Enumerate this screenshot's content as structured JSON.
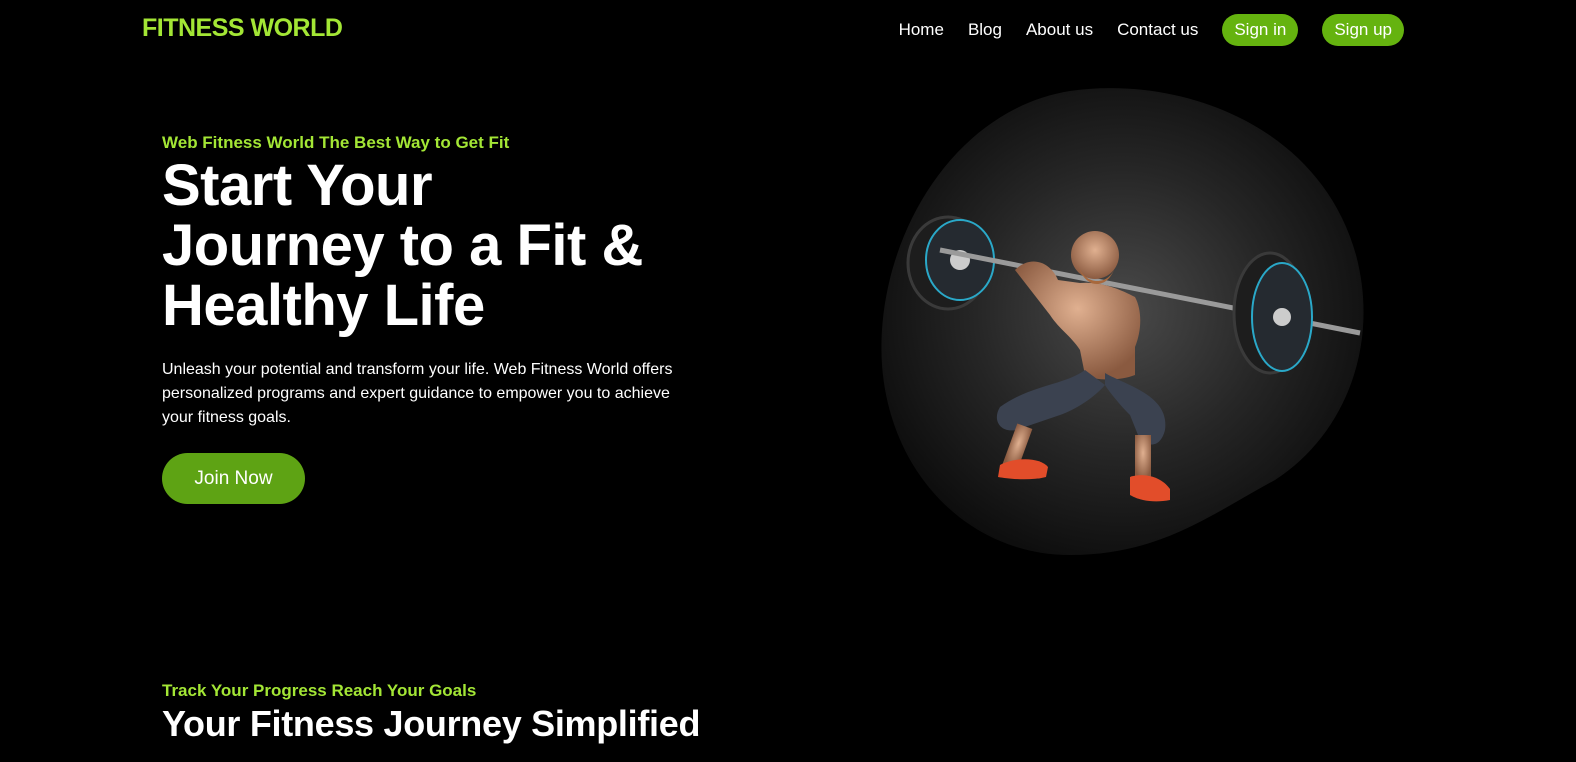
{
  "header": {
    "logo": "FITNESS WORLD",
    "nav": {
      "home": "Home",
      "blog": "Blog",
      "about": "About us",
      "contact": "Contact us",
      "sign_in": "Sign in",
      "sign_up": "Sign up"
    }
  },
  "hero": {
    "eyebrow": "Web Fitness World The Best Way to Get Fit",
    "title_line1": "Start Your",
    "title_line2": "Journey to a Fit &",
    "title_line3": "Healthy Life",
    "description": "Unleash your potential and transform your life. Web Fitness World offers personalized programs and expert guidance to empower you to achieve your fitness goals.",
    "cta": "Join Now",
    "image": "weightlifter-squat-photo"
  },
  "section": {
    "eyebrow": "Track Your Progress Reach Your Goals",
    "title": "Your Fitness Journey Simplified"
  },
  "colors": {
    "accent": "#a3e635",
    "button": "#65b30f",
    "cta": "#5ea314",
    "background": "#000000"
  }
}
